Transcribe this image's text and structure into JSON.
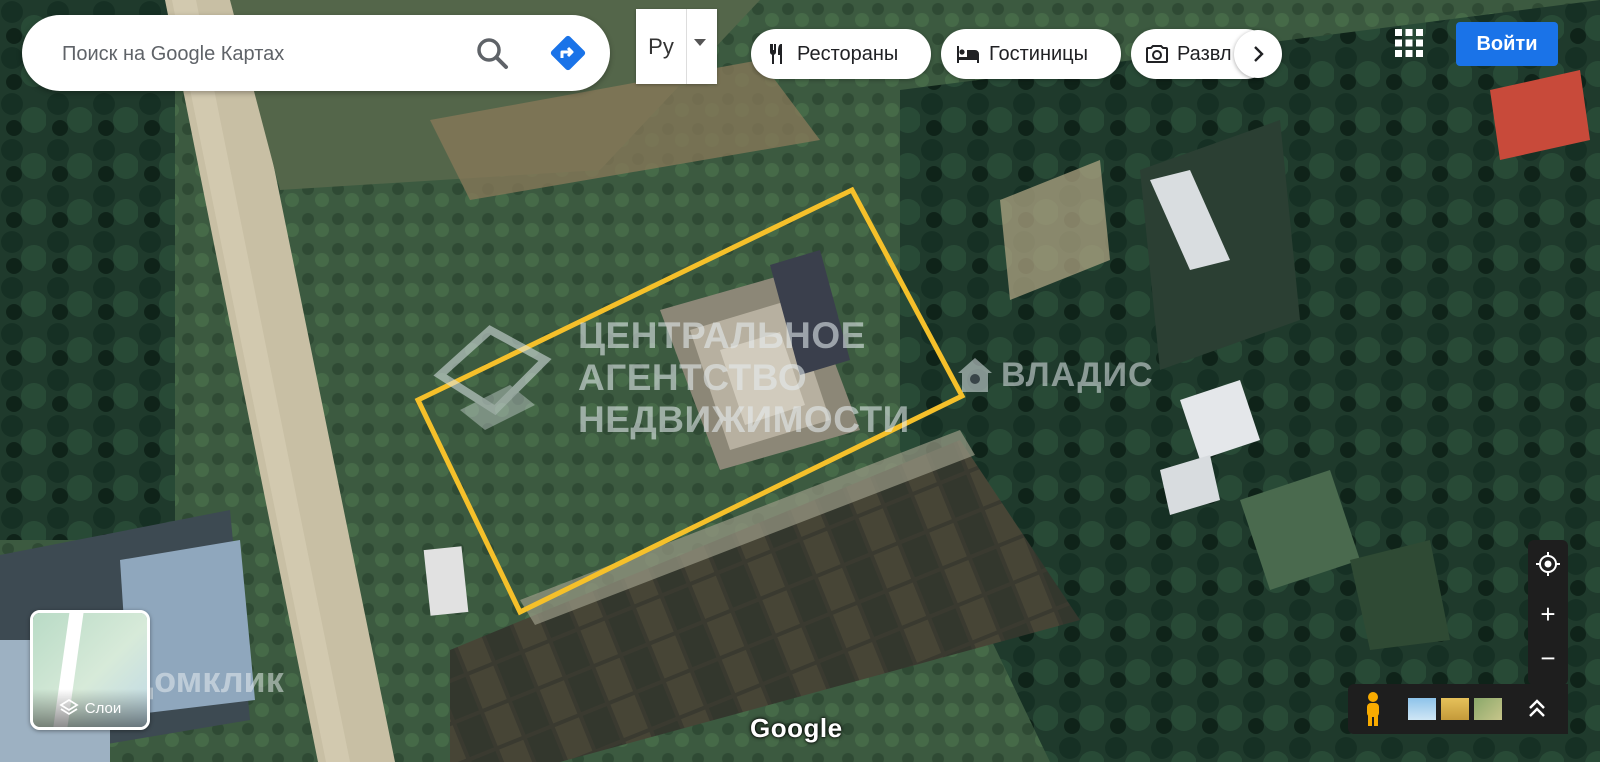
{
  "search": {
    "placeholder": "Поиск на Google Картах"
  },
  "input_tool": {
    "label": "Ру"
  },
  "chips": [
    {
      "label": "Рестораны",
      "icon": "fork-knife-icon"
    },
    {
      "label": "Гостиницы",
      "icon": "bed-icon"
    },
    {
      "label": "Развл",
      "icon": "camera-icon"
    }
  ],
  "header": {
    "signin_label": "Войти"
  },
  "layers": {
    "label": "Слои"
  },
  "watermarks": {
    "agency_line1": "ЦЕНТРАЛЬНОЕ",
    "agency_line2": "АГЕНТСТВО",
    "agency_line3": "НЕДВИЖИМОСТИ",
    "vladis": "ВЛАДИС",
    "domclick": "Домклик"
  },
  "map": {
    "attribution": "Google",
    "map_type": "satellite",
    "parcel_outline_color": "#f5c02a"
  },
  "controls": {
    "zoom_in": "+",
    "zoom_out": "−"
  }
}
